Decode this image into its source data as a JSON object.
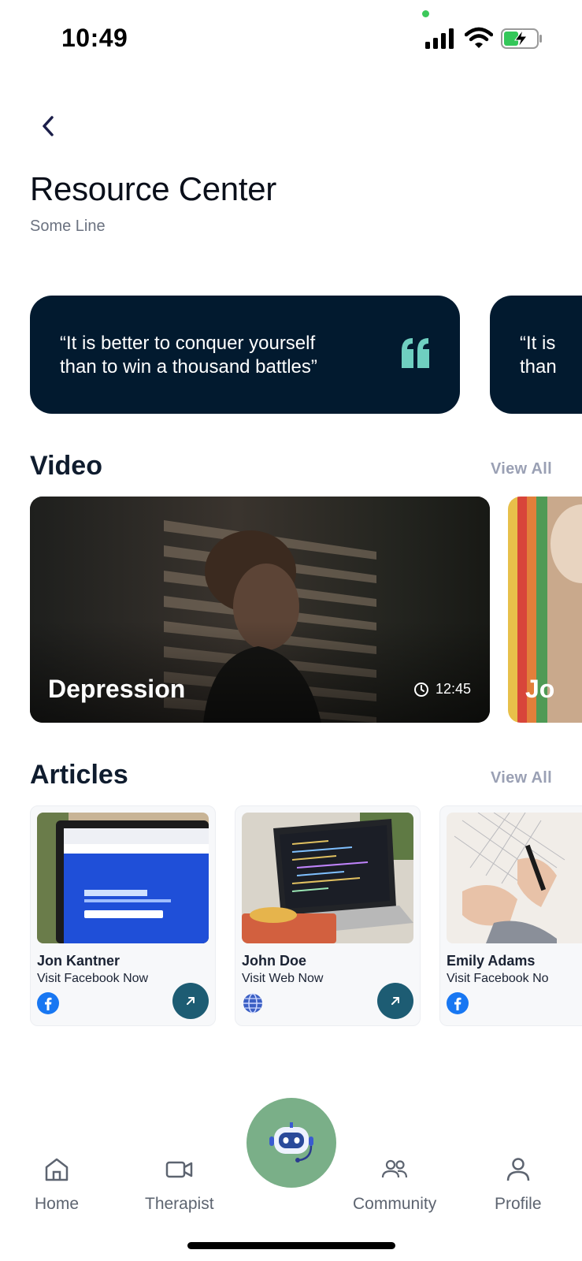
{
  "status_bar": {
    "time": "10:49"
  },
  "header": {
    "title": "Resource Center",
    "subtitle": "Some Line"
  },
  "quotes": [
    {
      "line1": "“It is better to conquer yourself",
      "line2": "than to win a thousand battles”"
    },
    {
      "line1": "“It is",
      "line2": "than"
    }
  ],
  "video_section": {
    "title": "Video",
    "view_all": "View All",
    "items": [
      {
        "label": "Depression",
        "duration": "12:45"
      },
      {
        "label": "Jo"
      }
    ]
  },
  "articles_section": {
    "title": "Articles",
    "view_all": "View All",
    "items": [
      {
        "author": "Jon Kantner",
        "link_text": "Visit Facebook Now",
        "source_icon": "facebook-icon"
      },
      {
        "author": "John Doe",
        "link_text": "Visit Web Now",
        "source_icon": "globe-icon"
      },
      {
        "author": "Emily Adams",
        "link_text": "Visit Facebook No",
        "source_icon": "facebook-icon"
      }
    ]
  },
  "bottom_nav": {
    "items": [
      {
        "label": "Home",
        "icon": "home-icon"
      },
      {
        "label": "Therapist",
        "icon": "video-camera-icon"
      },
      {
        "label": "Community",
        "icon": "people-icon"
      },
      {
        "label": "Profile",
        "icon": "person-icon"
      }
    ],
    "center_button_icon": "chatbot-icon"
  },
  "colors": {
    "quote_bg": "#021a2f",
    "accent_teal": "#1d5c73",
    "quote_icon": "#6fcfc0",
    "bot_button": "#7aaf88",
    "view_all": "#9aa0b4"
  }
}
